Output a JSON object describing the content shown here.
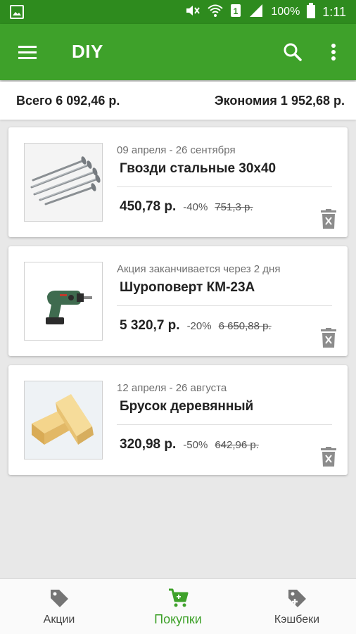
{
  "statusbar": {
    "battery": "100%",
    "time": "1:11"
  },
  "appbar": {
    "title": "DIY"
  },
  "summary": {
    "total": "Всего 6 092,46 р.",
    "saving": "Экономия 1 952,68 р."
  },
  "items": [
    {
      "period": "09 апреля - 26 сентября",
      "name": "Гвозди стальные 30х40",
      "price": "450,78 р.",
      "discount": "-40%",
      "old_price": "751,3 р.",
      "image": "nails"
    },
    {
      "period": "Акция заканчивается через 2 дня",
      "name": "Шуроповерт КМ-23А",
      "price": "5 320,7 р.",
      "discount": "-20%",
      "old_price": "6 650,88 р.",
      "image": "drill"
    },
    {
      "period": "12 апреля - 26 августа",
      "name": "Брусок деревянный",
      "price": "320,98 р.",
      "discount": "-50%",
      "old_price": "642,96 р.",
      "image": "wood-block"
    }
  ],
  "nav": [
    {
      "label": "Акции",
      "icon": "tag-icon"
    },
    {
      "label": "Покупки",
      "icon": "cart-icon",
      "active": true
    },
    {
      "label": "Кэшбеки",
      "icon": "tag-plus-icon"
    }
  ],
  "colors": {
    "primary": "#3ea12a",
    "statusbar": "#2e8b1e",
    "background": "#e8e8e8"
  }
}
